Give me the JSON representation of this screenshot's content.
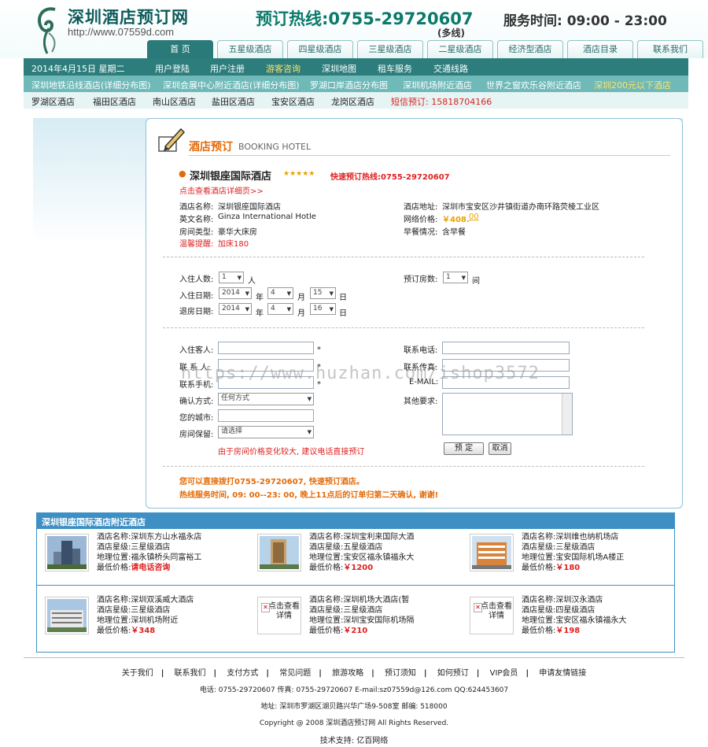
{
  "header": {
    "site_name": "深圳酒店预订网",
    "site_url": "http://www.07559d.com",
    "hotline": "预订热线:0755-29720607",
    "hotline_sub": "(多线)",
    "service_time": "服务时间: 09:00 - 23:00"
  },
  "main_tabs": [
    "首 页",
    "五星级酒店",
    "四星级酒店",
    "三星级酒店",
    "二星级酒店",
    "经济型酒店",
    "酒店目录",
    "联系我们"
  ],
  "nav1": {
    "date": "2014年4月15日 星期二",
    "items": [
      "用户登陆",
      "用户注册",
      "游客咨询",
      "深圳地图",
      "租车服务",
      "交通线路"
    ]
  },
  "nav2": [
    "深圳地铁沿线酒店(详细分布图)",
    "深圳会展中心附近酒店(详细分布图)",
    "罗湖口岸酒店分布图",
    "深圳机场附近酒店",
    "世界之窗欢乐谷附近酒店",
    "深圳200元以下酒店"
  ],
  "nav3": {
    "items": [
      "罗湖区酒店",
      "福田区酒店",
      "南山区酒店",
      "盐田区酒店",
      "宝安区酒店",
      "龙岗区酒店"
    ],
    "sms": "短信预订: 15818704166"
  },
  "booking": {
    "title": "酒店预订",
    "title_en": "BOOKING HOTEL",
    "hotel_name": "深圳银座国际酒店",
    "stars": "★★★★★",
    "quick_hotline": "快速预订热线:0755-29720607",
    "detail_link": "点击查看酒店详细页>>",
    "info": {
      "cn_name_label": "酒店名称:",
      "cn_name": "深圳银座国际酒店",
      "en_name_label": "英文名称:",
      "en_name": "Ginza International Hotle",
      "room_label": "房间类型:",
      "room": "豪华大床房",
      "tip_label": "温馨提醒:",
      "tip": "加床180",
      "addr_label": "酒店地址:",
      "addr": "深圳市宝安区沙井镇街道办南环路荧棱工业区",
      "price_label": "网络价格:",
      "price": "￥408.",
      "price_cents": "00",
      "breakfast_label": "早餐情况:",
      "breakfast": "含早餐"
    },
    "form": {
      "guests_label": "入住人数:",
      "guests": "1",
      "guests_unit": "人",
      "rooms_label": "预订房数:",
      "rooms": "1",
      "rooms_unit": "间",
      "checkin_label": "入住日期:",
      "checkin_y": "2014",
      "checkin_m": "4",
      "checkin_d": "15",
      "checkout_label": "退房日期:",
      "checkout_y": "2014",
      "checkout_m": "4",
      "checkout_d": "16",
      "year": "年",
      "month": "月",
      "day": "日",
      "guest_name_label": "入住客人:",
      "contact_label": "联 系 人:",
      "mobile_label": "联系手机:",
      "confirm_label": "确认方式:",
      "confirm_value": "任何方式",
      "city_label": "您的城市:",
      "hold_label": "房间保留:",
      "hold_value": "请选择",
      "phone_label": "联系电话:",
      "fax_label": "联系传真:",
      "email_label": "E-MAIL:",
      "other_label": "其他要求:",
      "required": "*",
      "note": "由于房间价格变化较大, 建议电话直接预订",
      "submit": "预 定",
      "cancel": "取消"
    },
    "notice1": "您可以直接拨打0755-29720607, 快速预订酒店。",
    "notice2": "热线服务时间, 09: 00--23: 00, 晚上11点后的订单归第二天确认, 谢谢!"
  },
  "nearby": {
    "title": "深圳银座国际酒店附近酒店",
    "labels": {
      "name": "酒店名称:",
      "star": "酒店星级:",
      "loc": "地理位置:",
      "price": "最低价格:"
    },
    "no_image": "点击查看详情",
    "hotels": [
      {
        "name": "深圳东方山水福永店",
        "star": "三星级酒店",
        "loc": "福永镇桥头同富裕工",
        "price": "请电话咨询"
      },
      {
        "name": "深圳宝利来国际大酒",
        "star": "五星级酒店",
        "loc": "宝安区福永镇福永大",
        "price": "￥1200"
      },
      {
        "name": "深圳维也纳机场店",
        "star": "三星级酒店",
        "loc": "宝安国际机场A楼正",
        "price": "￥180"
      },
      {
        "name": "深圳双溪威大酒店",
        "star": "三星级酒店",
        "loc": "深圳机场附近",
        "price": "￥348"
      },
      {
        "name": "深圳机场大酒店(暂",
        "star": "三星级酒店",
        "loc": "深圳宝安国际机场隔",
        "price": "￥210"
      },
      {
        "name": "深圳汉永酒店",
        "star": "四星级酒店",
        "loc": "宝安区福永镇福永大",
        "price": "￥198"
      }
    ]
  },
  "footer": {
    "links": [
      "关于我们",
      "联系我们",
      "支付方式",
      "常见问题",
      "旅游攻略",
      "预订须知",
      "如何预订",
      "VIP会员",
      "申请友情链接"
    ],
    "separator": "|",
    "contact": "电话: 0755-29720607 传真: 0755-29720607 E-mail:sz07559d@126.com QQ:624453607",
    "address": "地址: 深圳市罗湖区湖贝路兴华广场9-508室 邮编: 518000",
    "copyright": "Copyright @ 2008 深圳酒店预订网 All Rights Reserved.",
    "tech": "技术支持: 亿百网络"
  },
  "watermark": "https://www.huzhan.com/ishop3572"
}
